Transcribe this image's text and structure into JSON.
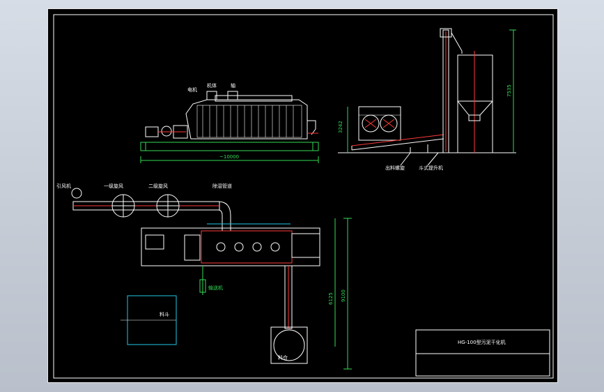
{
  "drawing": {
    "title_block": {
      "title": "HG-100型污泥干化机"
    },
    "dimensions": {
      "overall_length": "~10000",
      "side_height": "3242",
      "elevator_height": "7535",
      "plan_total": "9100",
      "plan_partial": "6125"
    },
    "labels": {
      "plan_blower_left": "引风机",
      "plan_cyclone_1": "一级旋风",
      "plan_cyclone_2": "二级旋风",
      "plan_duct": "除湿管道",
      "plan_storage": "料仓",
      "plan_hopper": "料斗",
      "plan_conveyor": "输送机",
      "side_label_1": "出料螺旋",
      "side_label_2": "斗式提升机",
      "front_label_a": "电机",
      "front_label_b": "机体",
      "front_label_c": "轴"
    }
  },
  "colors": {
    "sheet_background": "#000000",
    "line_white": "#ffffff",
    "line_green": "#33dd55",
    "line_red": "#ff3a3a",
    "line_cyan": "#20c8e8",
    "line_yellow": "#e8e84a"
  }
}
